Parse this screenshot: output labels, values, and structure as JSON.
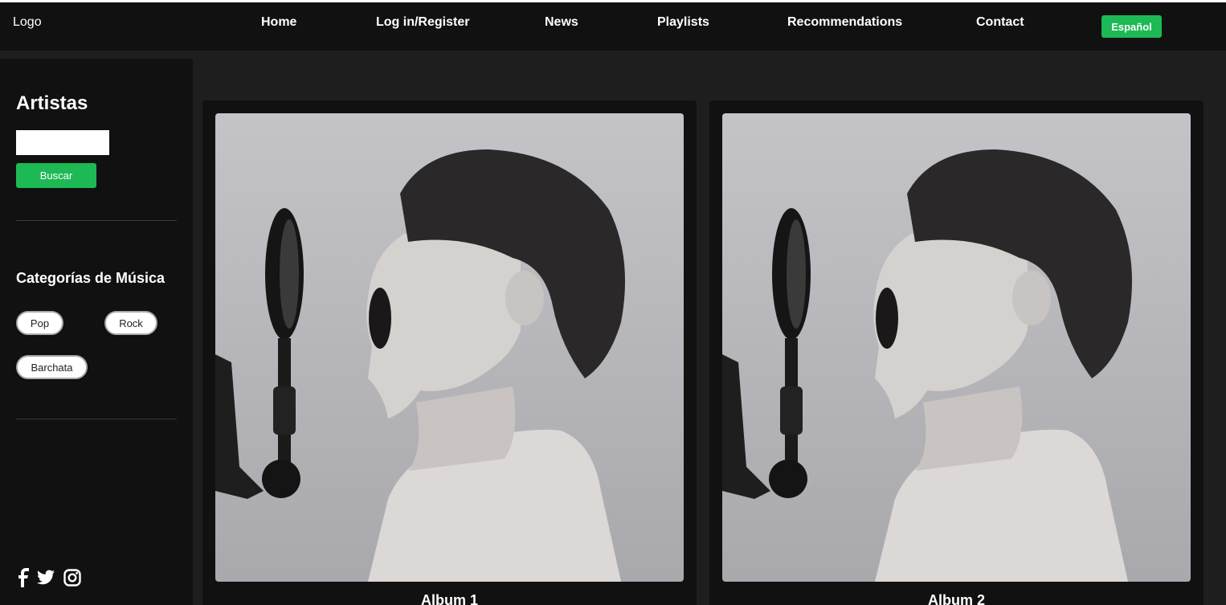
{
  "header": {
    "logo": "Logo",
    "nav": [
      {
        "label": "Home"
      },
      {
        "label": "Log in/Register"
      },
      {
        "label": "News"
      },
      {
        "label": "Playlists"
      },
      {
        "label": "Recommendations"
      },
      {
        "label": "Contact"
      }
    ],
    "language_button": "Español"
  },
  "sidebar": {
    "title": "Artistas",
    "search": {
      "value": "",
      "placeholder": ""
    },
    "search_button": "Buscar",
    "categories_title": "Categorías de Música",
    "categories": [
      "Pop",
      "Rock",
      "Barchata"
    ],
    "social_icons": [
      "facebook-icon",
      "twitter-icon",
      "instagram-icon"
    ]
  },
  "albums": [
    {
      "title": "Album 1"
    },
    {
      "title": "Album 2"
    }
  ],
  "colors": {
    "accent": "#1db954",
    "header_bg": "#111111",
    "page_bg": "#1e1e1e",
    "card_bg": "#111111"
  }
}
